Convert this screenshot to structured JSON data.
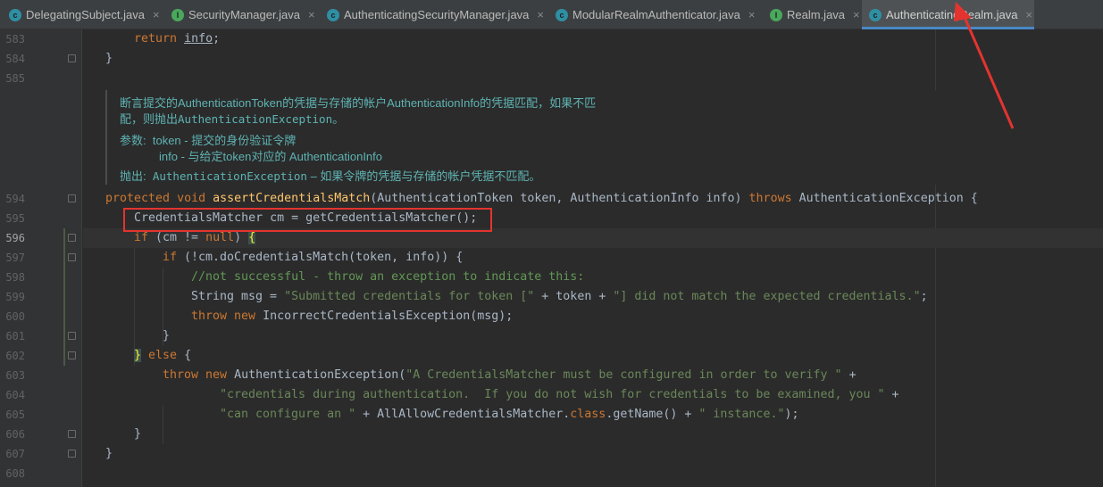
{
  "tabs": [
    {
      "label": "DelegatingSubject.java",
      "icon": "class-icon",
      "active": false
    },
    {
      "label": "SecurityManager.java",
      "icon": "interface-icon",
      "active": false
    },
    {
      "label": "AuthenticatingSecurityManager.java",
      "icon": "class-icon",
      "active": false
    },
    {
      "label": "ModularRealmAuthenticator.java",
      "icon": "class-icon",
      "active": false
    },
    {
      "label": "Realm.java",
      "icon": "interface-icon",
      "active": false
    },
    {
      "label": "AuthenticatingRealm.java",
      "icon": "class-icon",
      "active": true
    }
  ],
  "tab_close_glyph": "×",
  "line_numbers": [
    "583",
    "584",
    "585",
    "594",
    "595",
    "596",
    "597",
    "598",
    "599",
    "600",
    "601",
    "602",
    "603",
    "604",
    "605",
    "606",
    "607",
    "608"
  ],
  "doc": {
    "line1": "断言提交的AuthenticationToken的凭据与存储的帐户AuthenticationInfo的凭据匹配，如果不匹",
    "line2_prefix": "配，则抛出",
    "line2_code": "AuthenticationException",
    "line2_suffix": "。",
    "params_label": "参数:",
    "param1": "token - 提交的身份验证令牌",
    "param2": "info - 与给定token对应的 AuthenticationInfo",
    "throws_label": "抛出:",
    "throws_code": "AuthenticationException",
    "throws_text": " – 如果令牌的凭据与存储的帐户凭据不匹配。"
  },
  "code": {
    "l583_kw": "return",
    "l583_fld": "info",
    "l583_end": ";",
    "l584": "}",
    "l594_kw1": "protected",
    "l594_kw2": "void",
    "l594_fn": "assertCredentialsMatch",
    "l594_params": "(AuthenticationToken token, AuthenticationInfo info) ",
    "l594_kw3": "throws",
    "l594_rest": " AuthenticationException {",
    "l595": "CredentialsMatcher cm = getCredentialsMatcher();",
    "l596_kw": "if",
    "l596_cond": " (cm != ",
    "l596_null": "null",
    "l596_end": ") ",
    "l596_brace": "{",
    "l597_kw": "if",
    "l597_rest": " (!cm.doCredentialsMatch(token, info)) {",
    "l598": "//not successful - throw an exception to indicate this:",
    "l599_a": "String msg = ",
    "l599_s1": "\"Submitted credentials for token [\"",
    "l599_b": " + token + ",
    "l599_s2": "\"] did not match the expected credentials.\"",
    "l599_c": ";",
    "l600_kw1": "throw",
    "l600_kw2": "new",
    "l600_rest": " IncorrectCredentialsException(msg);",
    "l601": "}",
    "l602_a": "}",
    "l602_kw": "else",
    "l602_b": " {",
    "l603_kw1": "throw",
    "l603_kw2": "new",
    "l603_a": " AuthenticationException(",
    "l603_s": "\"A CredentialsMatcher must be configured in order to verify \"",
    "l603_b": " +",
    "l604_s": "\"credentials during authentication.  If you do not wish for credentials to be examined, you \"",
    "l604_b": " +",
    "l605_s1": "\"can configure an \"",
    "l605_a": " + AllAllowCredentialsMatcher.",
    "l605_kw": "class",
    "l605_b": ".getName() + ",
    "l605_s2": "\" instance.\"",
    "l605_c": ");",
    "l606": "}",
    "l607": "}"
  },
  "colors": {
    "keyword": "#cc7832",
    "method": "#ffc66d",
    "string": "#6a8759",
    "comment": "#629755",
    "doc": "#5fb3b3",
    "highlight_box": "#e3342f",
    "active_tab_underline": "#4a88c7"
  }
}
